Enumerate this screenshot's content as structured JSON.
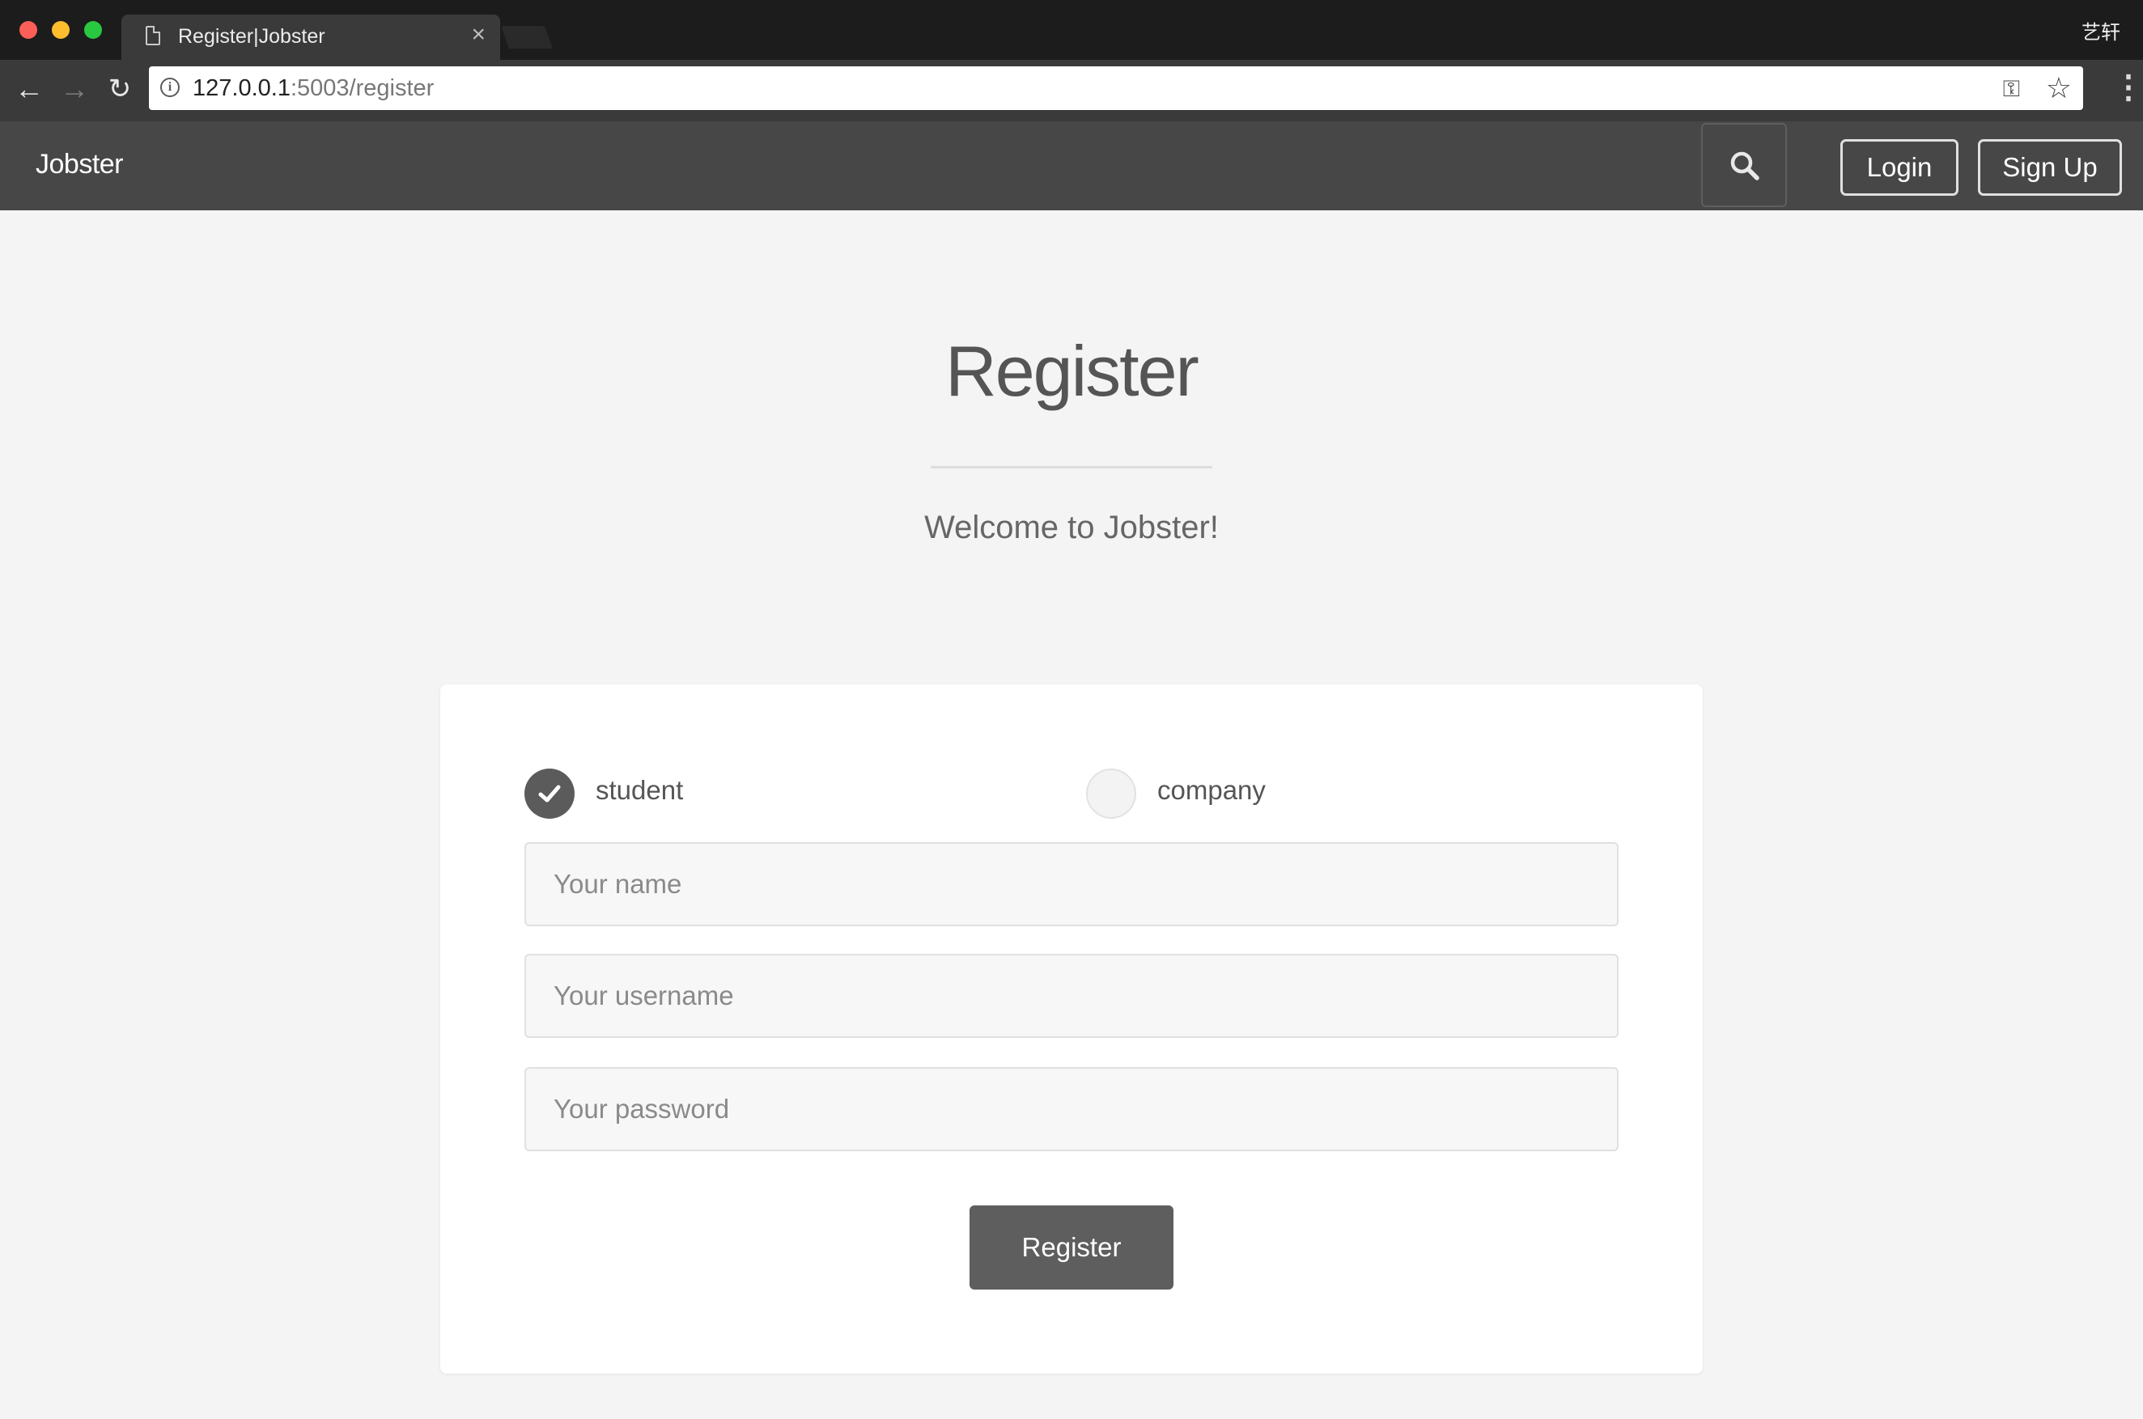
{
  "browser": {
    "tab_title": "Register|Jobster",
    "tab_close": "×",
    "profile_name": "艺轩",
    "url_host": "127.0.0.1",
    "url_rest": ":5003/register",
    "icons": {
      "back": "←",
      "forward": "→",
      "reload": "↻",
      "info": "i",
      "key": "⚿",
      "star": "☆",
      "menu": "⋮"
    }
  },
  "navbar": {
    "brand": "Jobster",
    "login_label": "Login",
    "signup_label": "Sign Up"
  },
  "page": {
    "title": "Register",
    "subtitle": "Welcome to Jobster!"
  },
  "form": {
    "account_types": [
      {
        "label": "student",
        "selected": true
      },
      {
        "label": "company",
        "selected": false
      }
    ],
    "name_placeholder": "Your name",
    "username_placeholder": "Your username",
    "password_placeholder": "Your password",
    "submit_label": "Register"
  },
  "colors": {
    "navbar_bg": "#474747",
    "button_bg": "#5e5e5e",
    "page_bg": "#f4f4f4"
  }
}
